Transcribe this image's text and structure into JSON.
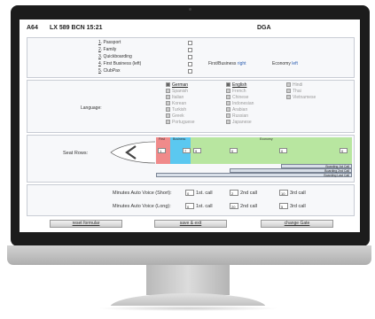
{
  "header": {
    "gate_code": "A64",
    "flight": "LX 589 BCN 15:21",
    "station": "DGA"
  },
  "options": {
    "items": [
      {
        "num": "1",
        "rest": ". Passport"
      },
      {
        "num": "2",
        "rest": ". Family"
      },
      {
        "num": "3",
        "rest": ". Quickboarding"
      },
      {
        "num": "4",
        "rest": ". First Business (left)"
      },
      {
        "num": "5",
        "rest": ". ClubPax"
      }
    ],
    "first_business_label": "First/Business",
    "first_business_side": "right",
    "economy_label": "Economy",
    "economy_side": "left"
  },
  "languages": {
    "label": "Language:",
    "col1": [
      "German",
      "Spanish",
      "Italian",
      "Korean",
      "Turkish",
      "Greek",
      "Portuguese"
    ],
    "col2": [
      "English",
      "French",
      "Chinese",
      "Indonesian",
      "Arabian",
      "Russian",
      "Japanese"
    ],
    "col3": [
      "Hindi",
      "Thai",
      "Vietnamese"
    ]
  },
  "seat_rows": {
    "label": "Seat Rows:",
    "first_label": "First",
    "business_label": "Business",
    "economy_label": "Economy",
    "inputs": [
      "1",
      "7",
      "9",
      "0",
      "0",
      "0"
    ],
    "bars": [
      "Boarding 1st Call",
      "Boarding 2nd Call",
      "Boarding Last Call"
    ],
    "colors": {
      "first": "#f08a8a",
      "business": "#5bc8f0",
      "economy": "#b8e6a0"
    }
  },
  "voice": {
    "short_label": "Minutes Auto Voice (Short):",
    "long_label": "Minutes Auto Voice (Long):",
    "short_values": [
      "0",
      "2",
      "10"
    ],
    "long_values": [
      "0",
      "20",
      "5"
    ],
    "call1": "1st. call",
    "call2": "2nd call",
    "call3": "3rd call"
  },
  "buttons": {
    "reset": "reset formular",
    "save": "save & exit",
    "gate": "change Gate"
  }
}
